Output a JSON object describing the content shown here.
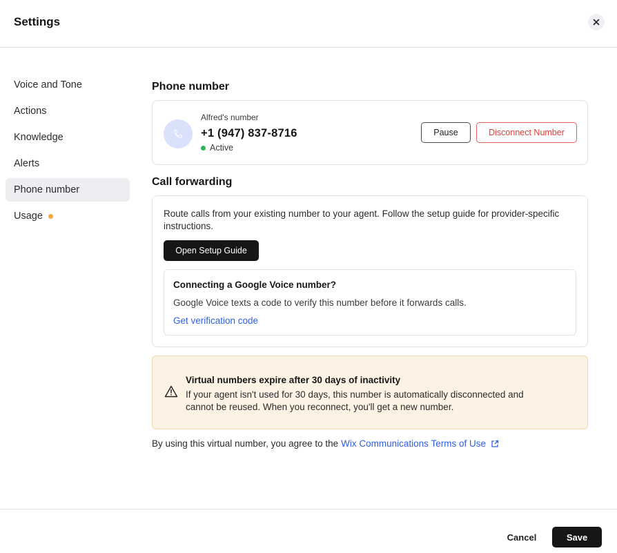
{
  "header": {
    "title": "Settings",
    "close_icon": "close-icon"
  },
  "sidebar": {
    "items": [
      {
        "label": "Voice and Tone",
        "active": false
      },
      {
        "label": "Actions",
        "active": false
      },
      {
        "label": "Knowledge",
        "active": false
      },
      {
        "label": "Alerts",
        "active": false
      },
      {
        "label": "Phone number",
        "active": true
      },
      {
        "label": "Usage",
        "active": false,
        "badge_color": "#f5a741"
      }
    ]
  },
  "phone_section": {
    "title": "Phone number",
    "icon": "phone-icon",
    "label": "Alfred's number",
    "number": "+1 (947) 837-8716",
    "status": "Active",
    "status_color": "#2eb55b",
    "pause_label": "Pause",
    "disconnect_label": "Disconnect Number"
  },
  "forwarding_section": {
    "title": "Call forwarding",
    "description": "Route calls from your existing number to your agent. Follow the setup guide for provider-specific instructions.",
    "setup_button": "Open Setup Guide",
    "google_voice": {
      "title": "Connecting a Google Voice number?",
      "text": "Google Voice texts a code to verify this number before it forwards calls.",
      "link": "Get verification code"
    }
  },
  "warning": {
    "icon": "warning-icon",
    "title": "Virtual numbers expire after 30 days of inactivity",
    "text": "If your agent isn't used for 30 days, this number is automatically disconnected and cannot be reused. When you reconnect, you'll get a new number."
  },
  "terms": {
    "prefix": "By using this virtual number, you agree to the",
    "link": "Wix Communications Terms of Use",
    "icon": "external-link-icon"
  },
  "footer": {
    "cancel_label": "Cancel",
    "save_label": "Save"
  },
  "colors": {
    "accent": "#2f5fe0",
    "danger": "#d9403a",
    "warning_bg": "#fdf3e5",
    "primary_button": "#161616"
  }
}
